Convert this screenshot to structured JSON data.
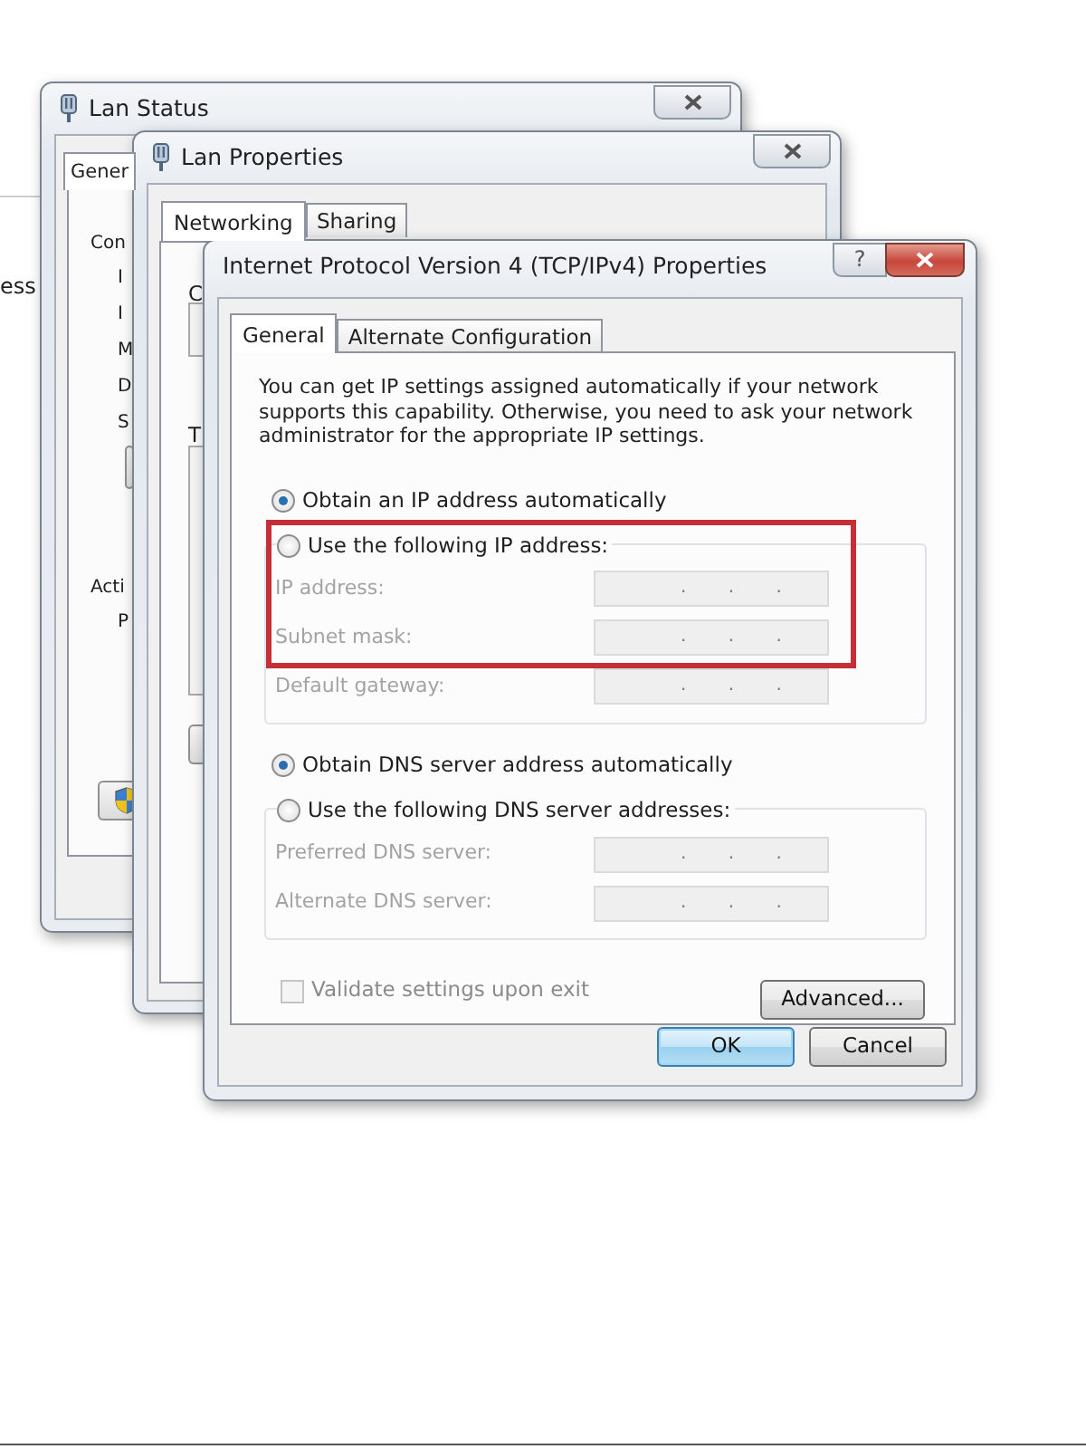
{
  "background_text": "ess",
  "status_window": {
    "title": "Lan Status",
    "tabs": [
      {
        "label": "Gener",
        "selected": true
      }
    ],
    "sections": [
      {
        "heading": "Con",
        "items": [
          "I",
          "I",
          "M",
          "D",
          "S"
        ]
      },
      {
        "heading": "Acti",
        "items": [
          "P"
        ]
      }
    ]
  },
  "properties_window": {
    "title": "Lan Properties",
    "tabs": [
      {
        "label": "Networking",
        "selected": true
      },
      {
        "label": "Sharing",
        "selected": false
      }
    ],
    "labels": [
      "C",
      "T"
    ]
  },
  "dialog": {
    "title": "Internet Protocol Version 4 (TCP/IPv4) Properties",
    "help": "?",
    "tabs": [
      {
        "label": "General",
        "selected": true
      },
      {
        "label": "Alternate Configuration",
        "selected": false
      }
    ],
    "description": "You can get IP settings assigned automatically if your network supports this capability. Otherwise, you need to ask your network administrator for the appropriate IP settings.",
    "ip_mode": [
      {
        "label": "Obtain an IP address automatically",
        "selected": true
      },
      {
        "label": "Use the following IP address:",
        "selected": false
      }
    ],
    "ip_fields": [
      {
        "label": "IP address:",
        "value": ". . .",
        "disabled": true
      },
      {
        "label": "Subnet mask:",
        "value": ". . .",
        "disabled": true
      },
      {
        "label": "Default gateway:",
        "value": ". . .",
        "disabled": true
      }
    ],
    "dns_mode": [
      {
        "label": "Obtain DNS server address automatically",
        "selected": true
      },
      {
        "label": "Use the following DNS server addresses:",
        "selected": false
      }
    ],
    "dns_fields": [
      {
        "label": "Preferred DNS server:",
        "value": ". . .",
        "disabled": true
      },
      {
        "label": "Alternate DNS server:",
        "value": ". . .",
        "disabled": true
      }
    ],
    "validate": {
      "label": "Validate settings upon exit",
      "checked": false,
      "disabled": true
    },
    "advanced_button": "Advanced...",
    "buttons": [
      {
        "label": "OK",
        "default": true
      },
      {
        "label": "Cancel",
        "default": false
      }
    ],
    "highlight": {
      "color": "#c62f36"
    }
  }
}
